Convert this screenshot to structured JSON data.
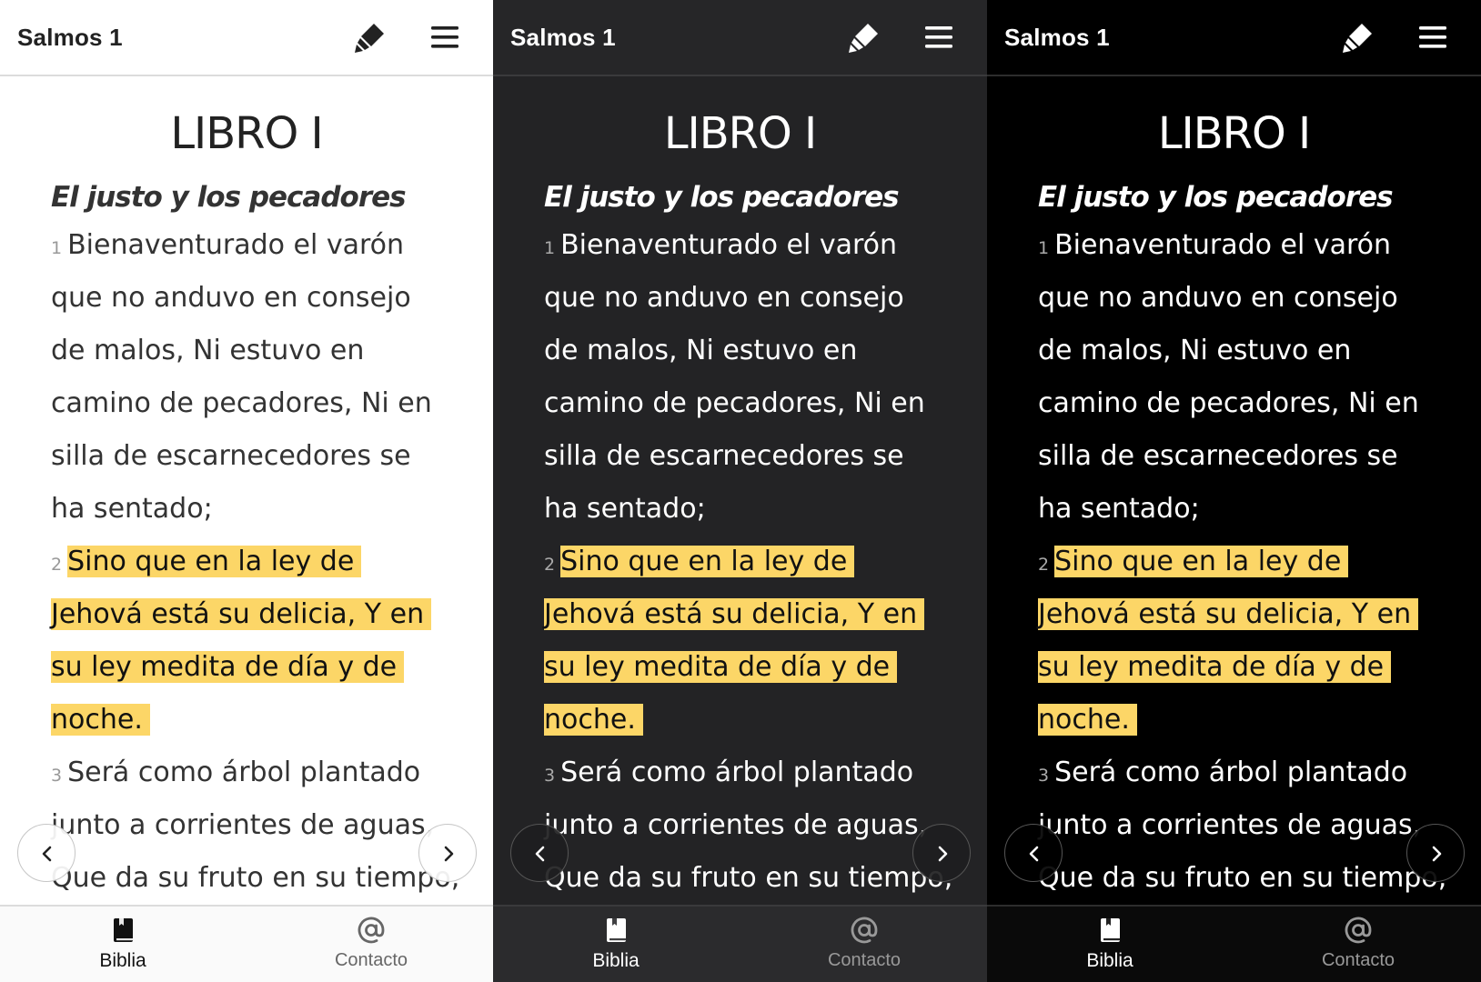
{
  "colors": {
    "highlight": "#fcd667",
    "light_bg": "#ffffff",
    "dark_bg": "#232325",
    "black_bg": "#000000"
  },
  "header": {
    "title": "Salmos 1",
    "icons": [
      "highlighter-icon",
      "hamburger-menu-icon"
    ]
  },
  "content": {
    "book_title": "LIBRO I",
    "section_title": "El justo y los pecadores",
    "lines": [
      {
        "num": "1",
        "text": "Bienaventurado el varón",
        "highlighted": false
      },
      {
        "num": "",
        "text": "que no anduvo en consejo",
        "highlighted": false
      },
      {
        "num": "",
        "text": "de malos, Ni estuvo en",
        "highlighted": false
      },
      {
        "num": "",
        "text": "camino de pecadores, Ni en",
        "highlighted": false
      },
      {
        "num": "",
        "text": "silla de escarnecedores se",
        "highlighted": false
      },
      {
        "num": "",
        "text": "ha sentado;",
        "highlighted": false
      },
      {
        "num": "2",
        "text": "Sino que en la ley de",
        "highlighted": true
      },
      {
        "num": "",
        "text": "Jehová está su delicia, Y en",
        "highlighted": true
      },
      {
        "num": "",
        "text": "su ley medita de día y de",
        "highlighted": true
      },
      {
        "num": "",
        "text": "noche.",
        "highlighted": true
      },
      {
        "num": "3",
        "text": "Será como árbol plantado",
        "highlighted": false
      },
      {
        "num": "",
        "text": "junto a corrientes de aguas,",
        "highlighted": false
      },
      {
        "num": "",
        "text": "Que da su fruto en su tiempo,",
        "highlighted": false
      }
    ]
  },
  "nav": {
    "prev_icon": "chevron-left-icon",
    "next_icon": "chevron-right-icon"
  },
  "bottom_nav": {
    "tabs": [
      {
        "label": "Biblia",
        "icon": "book-icon",
        "active": true
      },
      {
        "label": "Contacto",
        "icon": "at-sign-icon",
        "active": false
      }
    ]
  },
  "themes": [
    "light",
    "dark",
    "black"
  ]
}
